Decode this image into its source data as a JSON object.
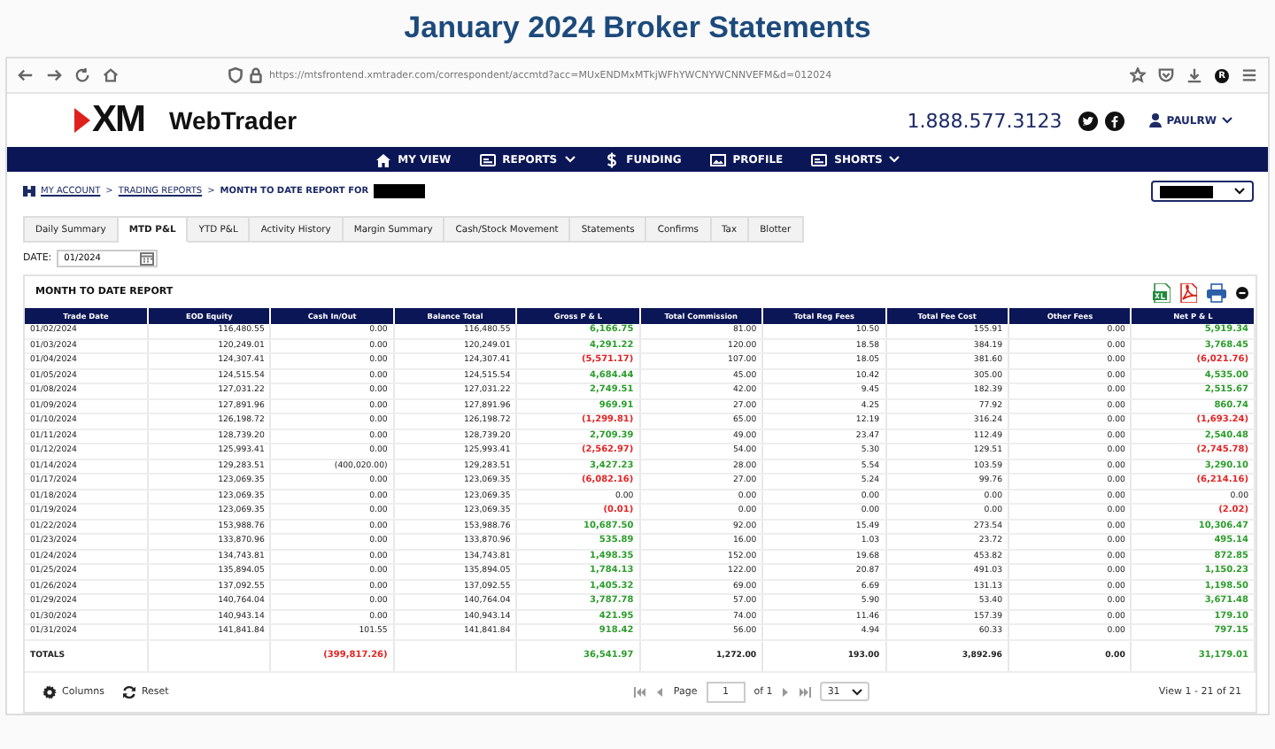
{
  "page_title": "January 2024 Broker Statements",
  "browser": {
    "url": "https://mtsfrontend.xmtrader.com/correspondent/accmtd?acc=MUxENDMxMTkjWFhYWCNYWCNNVEFM&d=012024",
    "profile_initial": "R"
  },
  "header": {
    "logo": "XM",
    "app_name": "WebTrader",
    "phone": "1.888.577.3123",
    "user": "PAULRW"
  },
  "nav": [
    {
      "label": "MY VIEW",
      "kind": "home",
      "dropdown": false
    },
    {
      "label": "REPORTS",
      "kind": "card",
      "dropdown": true
    },
    {
      "label": "FUNDING",
      "kind": "dollar",
      "dropdown": false
    },
    {
      "label": "PROFILE",
      "kind": "picture",
      "dropdown": false
    },
    {
      "label": "SHORTS",
      "kind": "card",
      "dropdown": true
    }
  ],
  "breadcrumb": [
    {
      "label": "MY ACCOUNT",
      "kind": "link"
    },
    {
      "label": ">",
      "kind": "sep"
    },
    {
      "label": "TRADING REPORTS",
      "kind": "link"
    },
    {
      "label": ">",
      "kind": "sep"
    },
    {
      "label": "MONTH TO DATE REPORT FOR",
      "kind": "current"
    }
  ],
  "tabs": [
    {
      "label": "Daily Summary",
      "selected": false
    },
    {
      "label": "MTD P&L",
      "selected": true
    },
    {
      "label": "YTD P&L",
      "selected": false
    },
    {
      "label": "Activity History",
      "selected": false
    },
    {
      "label": "Margin Summary",
      "selected": false
    },
    {
      "label": "Cash/Stock Movement",
      "selected": false
    },
    {
      "label": "Statements",
      "selected": false
    },
    {
      "label": "Confirms",
      "selected": false
    },
    {
      "label": "Tax",
      "selected": false
    },
    {
      "label": "Blotter",
      "selected": false
    }
  ],
  "date": {
    "label": "DATE:",
    "value": "01/2024"
  },
  "report": {
    "title": "MONTH TO DATE REPORT",
    "columns": [
      "Trade Date",
      "EOD Equity",
      "Cash In/Out",
      "Balance Total",
      "Gross P & L",
      "Total Commission",
      "Total Reg Fees",
      "Total Fee Cost",
      "Other Fees",
      "Net P & L"
    ],
    "rows": [
      [
        "01/02/2024",
        "116,480.55",
        "0.00",
        "116,480.55",
        {
          "text": "6,166.75",
          "color": "#2a9d2a"
        },
        "81.00",
        "10.50",
        "155.91",
        "0.00",
        {
          "text": "5,919.34",
          "color": "#2a9d2a"
        }
      ],
      [
        "01/03/2024",
        "120,249.01",
        "0.00",
        "120,249.01",
        {
          "text": "4,291.22",
          "color": "#2a9d2a"
        },
        "120.00",
        "18.58",
        "384.19",
        "0.00",
        {
          "text": "3,768.45",
          "color": "#2a9d2a"
        }
      ],
      [
        "01/04/2024",
        "124,307.41",
        "0.00",
        "124,307.41",
        {
          "text": "(5,571.17)",
          "color": "#e52222"
        },
        "107.00",
        "18.05",
        "381.60",
        "0.00",
        {
          "text": "(6,021.76)",
          "color": "#e52222"
        }
      ],
      [
        "01/05/2024",
        "124,515.54",
        "0.00",
        "124,515.54",
        {
          "text": "4,684.44",
          "color": "#2a9d2a"
        },
        "45.00",
        "10.42",
        "305.00",
        "0.00",
        {
          "text": "4,535.00",
          "color": "#2a9d2a"
        }
      ],
      [
        "01/08/2024",
        "127,031.22",
        "0.00",
        "127,031.22",
        {
          "text": "2,749.51",
          "color": "#2a9d2a"
        },
        "42.00",
        "9.45",
        "182.39",
        "0.00",
        {
          "text": "2,515.67",
          "color": "#2a9d2a"
        }
      ],
      [
        "01/09/2024",
        "127,891.96",
        "0.00",
        "127,891.96",
        {
          "text": "969.91",
          "color": "#2a9d2a"
        },
        "27.00",
        "4.25",
        "77.92",
        "0.00",
        {
          "text": "860.74",
          "color": "#2a9d2a"
        }
      ],
      [
        "01/10/2024",
        "126,198.72",
        "0.00",
        "126,198.72",
        {
          "text": "(1,299.81)",
          "color": "#e52222"
        },
        "65.00",
        "12.19",
        "316.24",
        "0.00",
        {
          "text": "(1,693.24)",
          "color": "#e52222"
        }
      ],
      [
        "01/11/2024",
        "128,739.20",
        "0.00",
        "128,739.20",
        {
          "text": "2,709.39",
          "color": "#2a9d2a"
        },
        "49.00",
        "23.47",
        "112.49",
        "0.00",
        {
          "text": "2,540.48",
          "color": "#2a9d2a"
        }
      ],
      [
        "01/12/2024",
        "125,993.41",
        "0.00",
        "125,993.41",
        {
          "text": "(2,562.97)",
          "color": "#e52222"
        },
        "54.00",
        "5.30",
        "129.51",
        "0.00",
        {
          "text": "(2,745.78)",
          "color": "#e52222"
        }
      ],
      [
        "01/14/2024",
        "129,283.51",
        "(400,020.00)",
        "129,283.51",
        {
          "text": "3,427.23",
          "color": "#2a9d2a"
        },
        "28.00",
        "5.54",
        "103.59",
        "0.00",
        {
          "text": "3,290.10",
          "color": "#2a9d2a"
        }
      ],
      [
        "01/17/2024",
        "123,069.35",
        "0.00",
        "123,069.35",
        {
          "text": "(6,082.16)",
          "color": "#e52222"
        },
        "27.00",
        "5.24",
        "99.76",
        "0.00",
        {
          "text": "(6,214.16)",
          "color": "#e52222"
        }
      ],
      [
        "01/18/2024",
        "123,069.35",
        "0.00",
        "123,069.35",
        "0.00",
        "0.00",
        "0.00",
        "0.00",
        "0.00",
        "0.00"
      ],
      [
        "01/19/2024",
        "123,069.35",
        "0.00",
        "123,069.35",
        {
          "text": "(0.01)",
          "color": "#e52222"
        },
        "0.00",
        "0.00",
        "0.00",
        "0.00",
        {
          "text": "(2.02)",
          "color": "#e52222"
        }
      ],
      [
        "01/22/2024",
        "153,988.76",
        "0.00",
        "153,988.76",
        {
          "text": "10,687.50",
          "color": "#2a9d2a"
        },
        "92.00",
        "15.49",
        "273.54",
        "0.00",
        {
          "text": "10,306.47",
          "color": "#2a9d2a"
        }
      ],
      [
        "01/23/2024",
        "133,870.96",
        "0.00",
        "133,870.96",
        {
          "text": "535.89",
          "color": "#2a9d2a"
        },
        "16.00",
        "1.03",
        "23.72",
        "0.00",
        {
          "text": "495.14",
          "color": "#2a9d2a"
        }
      ],
      [
        "01/24/2024",
        "134,743.81",
        "0.00",
        "134,743.81",
        {
          "text": "1,498.35",
          "color": "#2a9d2a"
        },
        "152.00",
        "19.68",
        "453.82",
        "0.00",
        {
          "text": "872.85",
          "color": "#2a9d2a"
        }
      ],
      [
        "01/25/2024",
        "135,894.05",
        "0.00",
        "135,894.05",
        {
          "text": "1,784.13",
          "color": "#2a9d2a"
        },
        "122.00",
        "20.87",
        "491.03",
        "0.00",
        {
          "text": "1,150.23",
          "color": "#2a9d2a"
        }
      ],
      [
        "01/26/2024",
        "137,092.55",
        "0.00",
        "137,092.55",
        {
          "text": "1,405.32",
          "color": "#2a9d2a"
        },
        "69.00",
        "6.69",
        "131.13",
        "0.00",
        {
          "text": "1,198.50",
          "color": "#2a9d2a"
        }
      ],
      [
        "01/29/2024",
        "140,764.04",
        "0.00",
        "140,764.04",
        {
          "text": "3,787.78",
          "color": "#2a9d2a"
        },
        "57.00",
        "5.90",
        "53.40",
        "0.00",
        {
          "text": "3,671.48",
          "color": "#2a9d2a"
        }
      ],
      [
        "01/30/2024",
        "140,943.14",
        "0.00",
        "140,943.14",
        {
          "text": "421.95",
          "color": "#2a9d2a"
        },
        "74.00",
        "11.46",
        "157.39",
        "0.00",
        {
          "text": "179.10",
          "color": "#2a9d2a"
        }
      ],
      [
        "01/31/2024",
        "141,841.84",
        "101.55",
        "141,841.84",
        {
          "text": "918.42",
          "color": "#2a9d2a"
        },
        "56.00",
        "4.94",
        "60.33",
        "0.00",
        {
          "text": "797.15",
          "color": "#2a9d2a"
        }
      ]
    ],
    "totals": {
      "trade_date": "TOTALS",
      "cash_in_out": {
        "text": "(399,817.26)",
        "color": "#e52222"
      },
      "gross_pl": {
        "text": "36,541.97",
        "color": "#2a9d2a"
      },
      "total_commission": "1,272.00",
      "total_reg_fees": "193.00",
      "total_fee_cost": "3,892.96",
      "other_fees": "0.00",
      "net_pl": {
        "text": "31,179.01",
        "color": "#2a9d2a"
      }
    }
  },
  "pager": {
    "columns_button": "Columns",
    "reset_button": "Reset",
    "page_label": "Page",
    "page": "1",
    "of_label": "of 1",
    "page_size": "31",
    "view": "View 1 - 21 of 21"
  }
}
